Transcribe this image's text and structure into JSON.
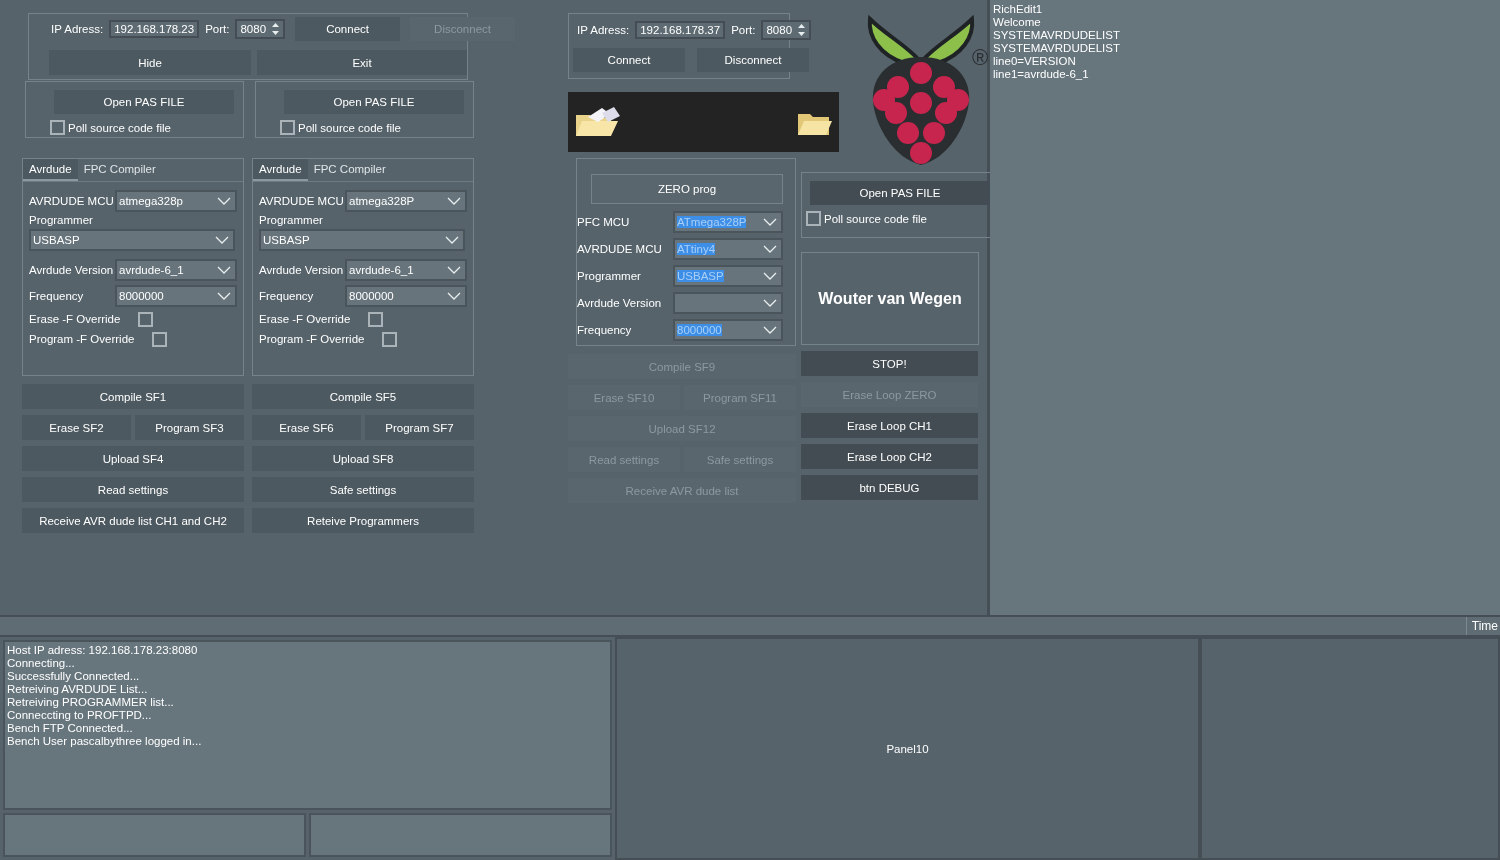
{
  "left_pair": {
    "connection": {
      "ip_label": "IP Adress:",
      "ip": "192.168.178.23",
      "port_label": "Port:",
      "port": "8080",
      "buttons": [
        {
          "label": "Connect",
          "disabled": false
        },
        {
          "label": "Disconnect",
          "disabled": true
        }
      ],
      "actions": [
        {
          "label": "Hide",
          "disabled": false
        },
        {
          "label": "Exit",
          "disabled": false
        }
      ]
    },
    "channels": [
      {
        "file_box": {
          "button": {
            "label": "Open PAS FILE",
            "disabled": false
          },
          "poll": {
            "label": "Poll source code file",
            "checked": false
          }
        },
        "tabs": [
          {
            "label": "Avrdude",
            "selected": true
          },
          {
            "label": "FPC Compiler",
            "selected": false
          }
        ],
        "fields": [
          {
            "kind": "select",
            "label": "AVRDUDE MCU",
            "value": "atmega328p"
          },
          {
            "kind": "stacked",
            "label": "Programmer",
            "value": "USBASP"
          },
          {
            "kind": "select",
            "label": "Avrdude Version",
            "value": "avrdude-6_1"
          },
          {
            "kind": "select",
            "label": "Frequency",
            "value": "8000000"
          },
          {
            "kind": "check",
            "label": "Erase -F Override",
            "checked": false
          },
          {
            "kind": "check",
            "label": "Program -F Override",
            "checked": false
          }
        ],
        "buttons": [
          [
            {
              "label": "Compile SF1",
              "disabled": false
            }
          ],
          [
            {
              "label": "Erase SF2",
              "disabled": false
            },
            {
              "label": "Program SF3",
              "disabled": false
            }
          ],
          [
            {
              "label": "Upload SF4",
              "disabled": false
            }
          ],
          [
            {
              "label": "Read settings",
              "disabled": false
            }
          ],
          [
            {
              "label": "Receive AVR dude list CH1 and CH2",
              "disabled": false
            }
          ]
        ]
      },
      {
        "file_box": {
          "button": {
            "label": "Open PAS FILE",
            "disabled": false
          },
          "poll": {
            "label": "Poll source code file",
            "checked": false
          }
        },
        "tabs": [
          {
            "label": "Avrdude",
            "selected": true
          },
          {
            "label": "FPC Compiler",
            "selected": false
          }
        ],
        "fields": [
          {
            "kind": "select",
            "label": "AVRDUDE MCU",
            "value": "atmega328P"
          },
          {
            "kind": "stacked",
            "label": "Programmer",
            "value": "USBASP"
          },
          {
            "kind": "select",
            "label": "Avrdude Version",
            "value": "avrdude-6_1"
          },
          {
            "kind": "select",
            "label": "Frequency",
            "value": "8000000"
          },
          {
            "kind": "check",
            "label": "Erase -F Override",
            "checked": false
          },
          {
            "kind": "check",
            "label": "Program -F Override",
            "checked": false
          }
        ],
        "buttons": [
          [
            {
              "label": "Compile SF5",
              "disabled": false
            }
          ],
          [
            {
              "label": "Erase SF6",
              "disabled": false
            },
            {
              "label": "Program SF7",
              "disabled": false
            }
          ],
          [
            {
              "label": "Upload SF8",
              "disabled": false
            }
          ],
          [
            {
              "label": "Safe settings",
              "disabled": false
            }
          ],
          [
            {
              "label": "Reteive Programmers",
              "disabled": false
            }
          ]
        ]
      }
    ]
  },
  "zero_column": {
    "connection": {
      "ip_label": "IP Adress:",
      "ip": "192.168.178.37",
      "port_label": "Port:",
      "port": "8080",
      "buttons": [
        {
          "label": "Connect",
          "disabled": false
        },
        {
          "label": "Disconnect",
          "disabled": false
        }
      ]
    },
    "zero_button": {
      "label": "ZERO prog",
      "disabled": false
    },
    "fields": [
      {
        "kind": "select",
        "label": "PFC MCU",
        "value": "ATmega328P",
        "highlighted": true
      },
      {
        "kind": "select",
        "label": "AVRDUDE MCU",
        "value": "ATtiny4",
        "highlighted": true
      },
      {
        "kind": "select",
        "label": "Programmer",
        "value": "USBASP",
        "highlighted": true
      },
      {
        "kind": "select",
        "label": "Avrdude Version"
      },
      {
        "kind": "select",
        "label": "Frequency",
        "value": "8000000",
        "highlighted": true
      }
    ],
    "buttons": [
      [
        {
          "label": "Compile SF9",
          "disabled": true
        }
      ],
      [
        {
          "label": "Erase SF10",
          "disabled": true
        },
        {
          "label": "Program SF11",
          "disabled": true
        }
      ],
      [
        {
          "label": "Upload SF12",
          "disabled": true
        }
      ],
      [
        {
          "label": "Read settings",
          "disabled": true
        },
        {
          "label": "Safe settings",
          "disabled": true
        }
      ],
      [
        {
          "label": "Receive AVR dude list",
          "disabled": true
        }
      ]
    ]
  },
  "right_column": {
    "logo_mark": "®",
    "file_box": {
      "button": {
        "label": "Open PAS FILE",
        "disabled": false
      },
      "poll": {
        "label": "Poll source code file",
        "checked": false
      }
    },
    "author": "Wouter van Wegen",
    "buttons": [
      [
        {
          "label": "STOP!",
          "disabled": false
        }
      ],
      [
        {
          "label": "Erase Loop ZERO",
          "disabled": true
        }
      ],
      [
        {
          "label": "Erase Loop CH1",
          "disabled": false
        }
      ],
      [
        {
          "label": "Erase Loop CH2",
          "disabled": false
        }
      ],
      [
        {
          "label": "btn DEBUG",
          "disabled": false
        }
      ]
    ]
  },
  "rich_edit": {
    "lines": [
      "RichEdit1",
      "Welcome",
      "SYSTEMAVRDUDELIST",
      "SYSTEMAVRDUDELIST",
      "line0=VERSION",
      "line1=avrdude-6_1"
    ]
  },
  "grid_header": {
    "column": "Time"
  },
  "log": {
    "lines": [
      "Host IP adress: 192.168.178.23:8080",
      "Connecting...",
      "Successfully Connected...",
      "Retreiving AVRDUDE List...",
      "Retreiving PROGRAMMER list...",
      "Conneccting to PROFTPD...",
      "Bench FTP Connected...",
      "Bench User pascalbythree logged in..."
    ]
  },
  "panel10": {
    "caption": "Panel10"
  }
}
